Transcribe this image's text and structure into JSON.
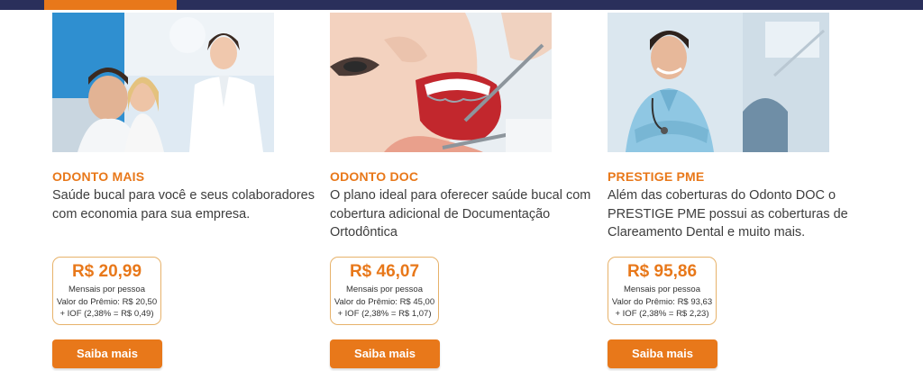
{
  "theme": {
    "accent": "#e8781a",
    "navy": "#2a2f5b",
    "text": "#3d3d3d"
  },
  "plans": [
    {
      "name": "ODONTO MAIS",
      "description": "Saúde bucal para você e seus colaboradores com economia para sua empresa.",
      "price": "R$ 20,99",
      "per_person": "Mensais por pessoa",
      "premium": "Valor do Prêmio: R$ 20,50",
      "iof": "+ IOF (2,38% = R$ 0,49)",
      "button": "Saiba mais"
    },
    {
      "name": "ODONTO DOC",
      "description": "O plano ideal para oferecer saúde bucal com cobertura adicional de Documentação Ortodôntica",
      "price": "R$ 46,07",
      "per_person": "Mensais por pessoa",
      "premium": "Valor do Prêmio: R$ 45,00",
      "iof": "+ IOF (2,38% = R$ 1,07)",
      "button": "Saiba mais"
    },
    {
      "name": "PRESTIGE PME",
      "description": "Além das coberturas do Odonto DOC o PRESTIGE PME possui as coberturas de Clareamento Dental e muito mais.",
      "price": "R$ 95,86",
      "per_person": "Mensais por pessoa",
      "premium": "Valor do Prêmio: R$ 93,63",
      "iof": "+ IOF (2,38% = R$ 2,23)",
      "button": "Saiba mais"
    }
  ]
}
